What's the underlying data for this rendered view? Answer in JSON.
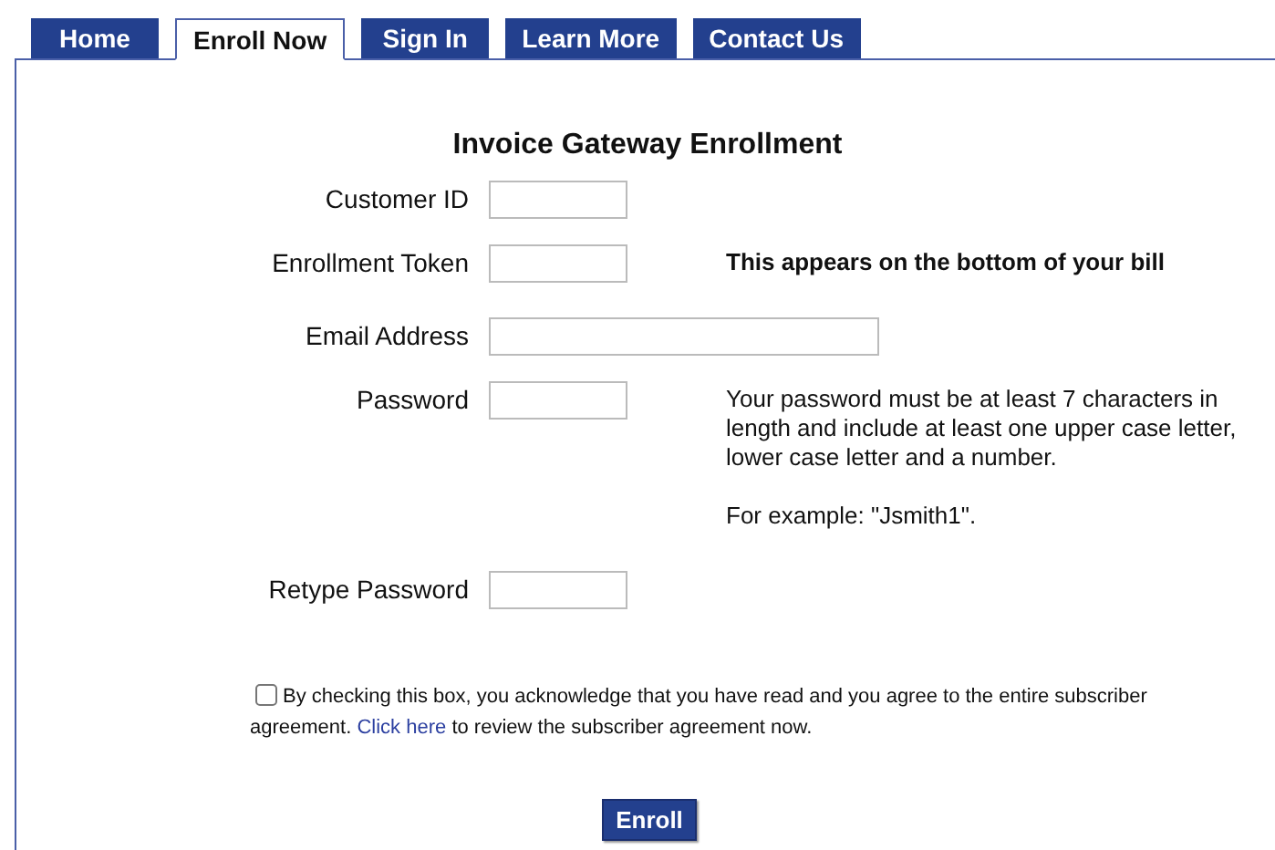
{
  "tabs": [
    {
      "label": "Home",
      "selected": false
    },
    {
      "label": "Enroll Now",
      "selected": true
    },
    {
      "label": "Sign In",
      "selected": false
    },
    {
      "label": "Learn More",
      "selected": false
    },
    {
      "label": "Contact Us",
      "selected": false
    }
  ],
  "title": "Invoice Gateway Enrollment",
  "fields": [
    {
      "label": "Customer ID",
      "kind": "short"
    },
    {
      "label": "Enrollment Token",
      "kind": "short",
      "notes": [
        {
          "text": "This appears on the bottom of your bill",
          "bold": true
        }
      ]
    },
    {
      "label": "Email Address",
      "kind": "long"
    },
    {
      "label": "Password",
      "kind": "short",
      "notes": [
        {
          "text": "Your password must be at least 7 characters in length and include at least one upper case letter, lower case letter and a number.",
          "bold": false
        },
        {
          "text": "For example: \"Jsmith1\".",
          "bold": false
        }
      ]
    },
    {
      "label": "Retype Password",
      "kind": "short"
    }
  ],
  "agreement": {
    "checked": false,
    "text_before": "By checking this box, you acknowledge that you have read and you agree to the entire subscriber agreement.",
    "link": "Click here",
    "text_after": "to review the subscriber agreement now."
  },
  "submit": "Enroll"
}
